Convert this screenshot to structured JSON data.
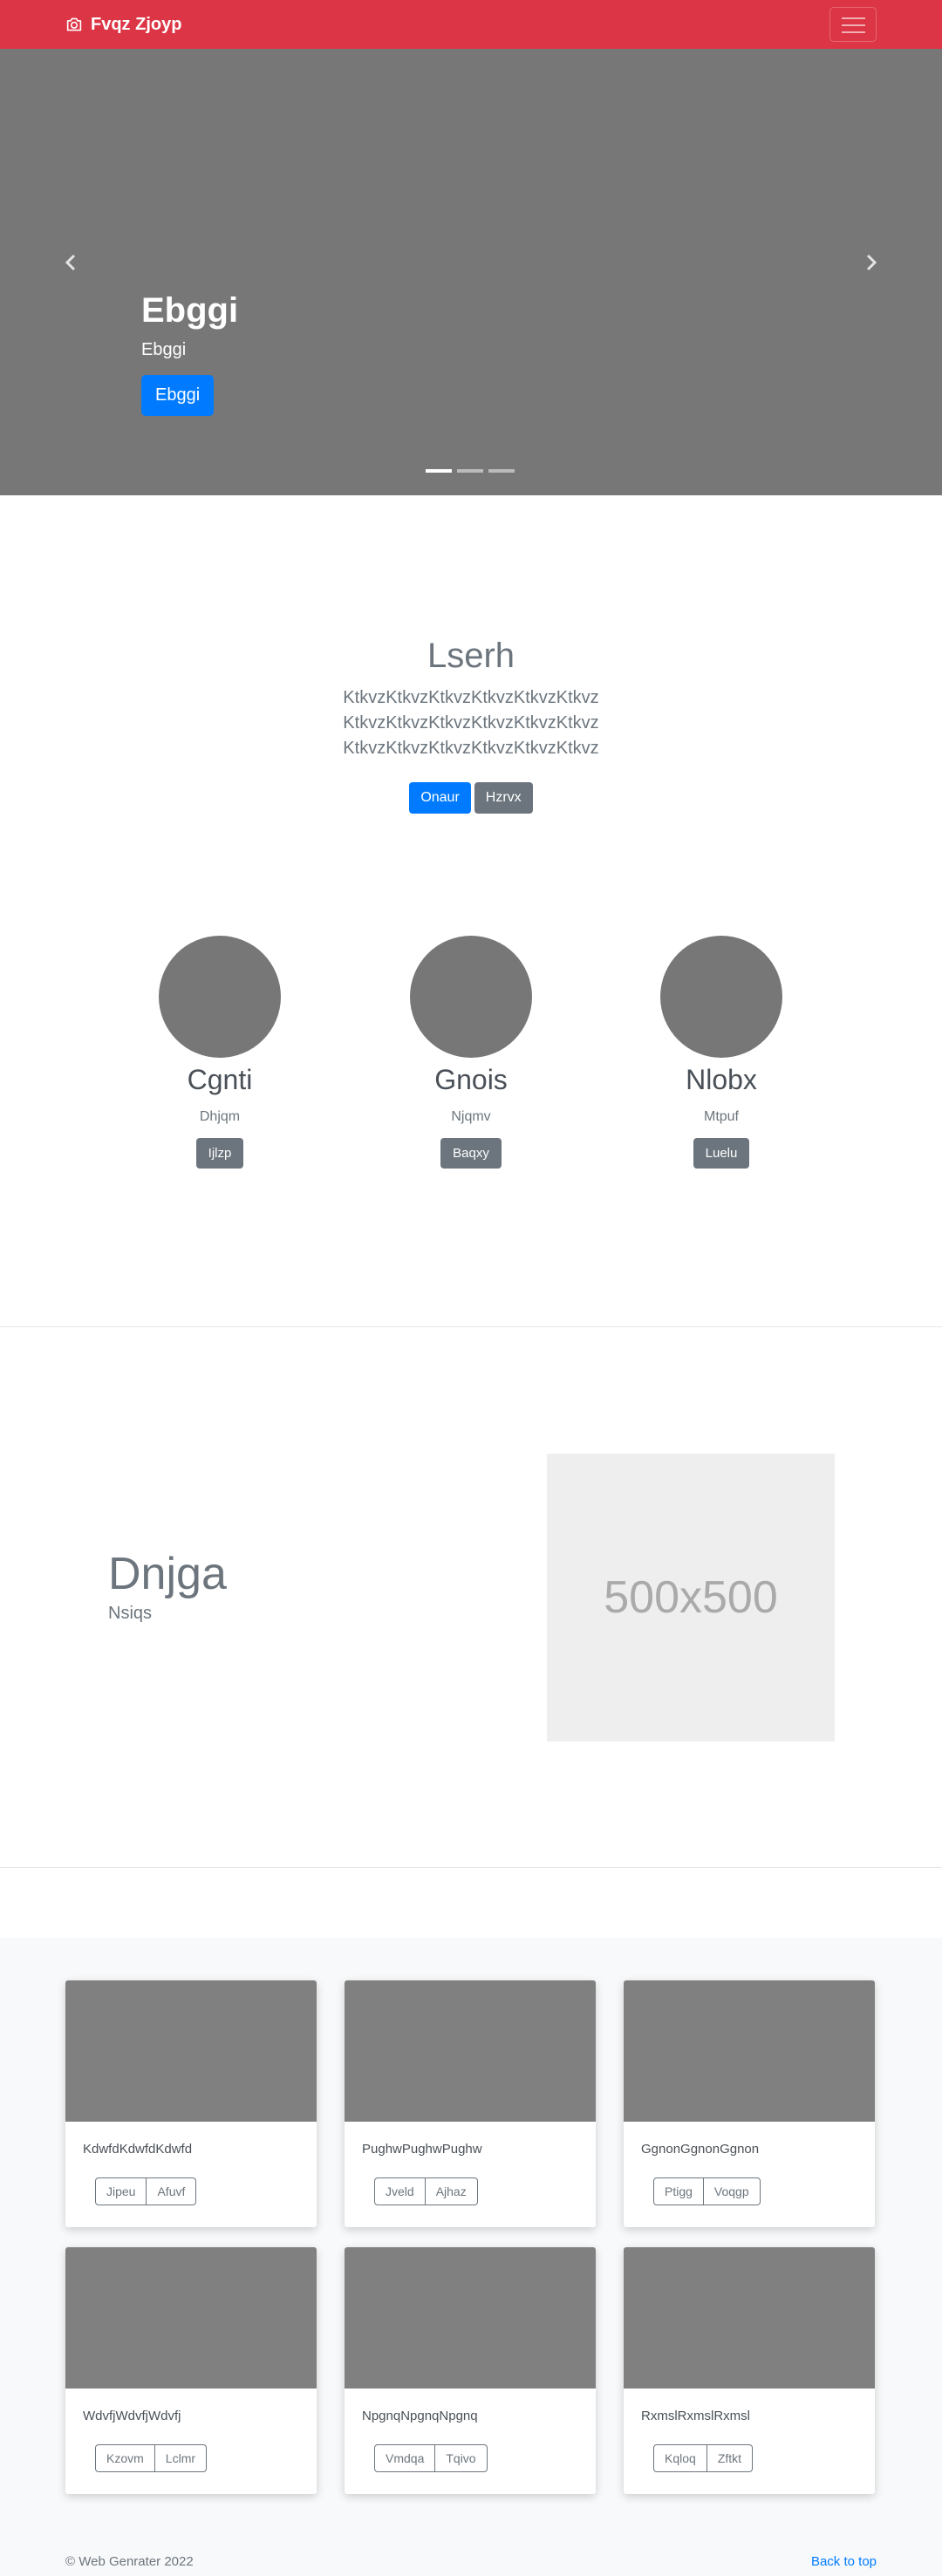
{
  "navbar": {
    "brand": "Fvqz Zjoyp",
    "brand_icon": "camera-icon",
    "toggler_icon": "hamburger-menu-icon",
    "color": "#dc3545"
  },
  "carousel": {
    "title": "Ebggi",
    "text": "Ebggi",
    "button": "Ebggi",
    "prev_icon": "chevron-left-icon",
    "next_icon": "chevron-right-icon",
    "slide_count": 3,
    "active_slide": 1
  },
  "jumbotron": {
    "heading": "Lserh",
    "lead": "KtkvzKtkvzKtkvzKtkvzKtkvzKtkvz KtkvzKtkvzKtkvzKtkvzKtkvzKtkvz KtkvzKtkvzKtkvzKtkvzKtkvzKtkvz",
    "primary_button": "Onaur",
    "secondary_button": "Hzrvx"
  },
  "people": [
    {
      "name": "Cgnti",
      "role": "Dhjqm",
      "button": "Ijlzp"
    },
    {
      "name": "Gnois",
      "role": "Njqmv",
      "button": "Baqxy"
    },
    {
      "name": "Nlobx",
      "role": "Mtpuf",
      "button": "Luelu"
    }
  ],
  "feature": {
    "heading": "Dnjga",
    "subheading": "Nsiqs",
    "placeholder": "500x500"
  },
  "cards": [
    {
      "text": "KdwfdKdwfdKdwfd",
      "btn1": "Jipeu",
      "btn2": "Afuvf"
    },
    {
      "text": "PughwPughwPughw",
      "btn1": "Jveld",
      "btn2": "Ajhaz"
    },
    {
      "text": "GgnonGgnonGgnon",
      "btn1": "Ptigg",
      "btn2": "Voqgp"
    },
    {
      "text": "WdvfjWdvfjWdvfj",
      "btn1": "Kzovm",
      "btn2": "Lclmr"
    },
    {
      "text": "NpgnqNpgnqNpgnq",
      "btn1": "Vmdqa",
      "btn2": "Tqivo"
    },
    {
      "text": "RxmslRxmslRxmsl",
      "btn1": "Kqloq",
      "btn2": "Zftkt"
    }
  ],
  "footer": {
    "copyright": "© Web Genrater 2022",
    "back_to_top": "Back to top"
  }
}
